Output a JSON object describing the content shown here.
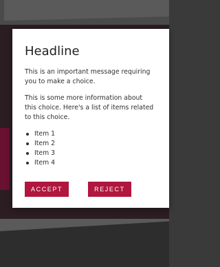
{
  "dialog": {
    "headline": "Headline",
    "paragraph1": "This is an important message requiring you to make a choice.",
    "paragraph2": "This is some more information about this choice. Here's a list of items related to this choice.",
    "items": [
      "Item 1",
      "Item 2",
      "Item 3",
      "Item 4"
    ],
    "accept_label": "ACCEPT",
    "reject_label": "REJECT"
  },
  "colors": {
    "accent": "#b0163e",
    "dialog_bg": "#ffffff",
    "scrim": "#2b1d22"
  }
}
